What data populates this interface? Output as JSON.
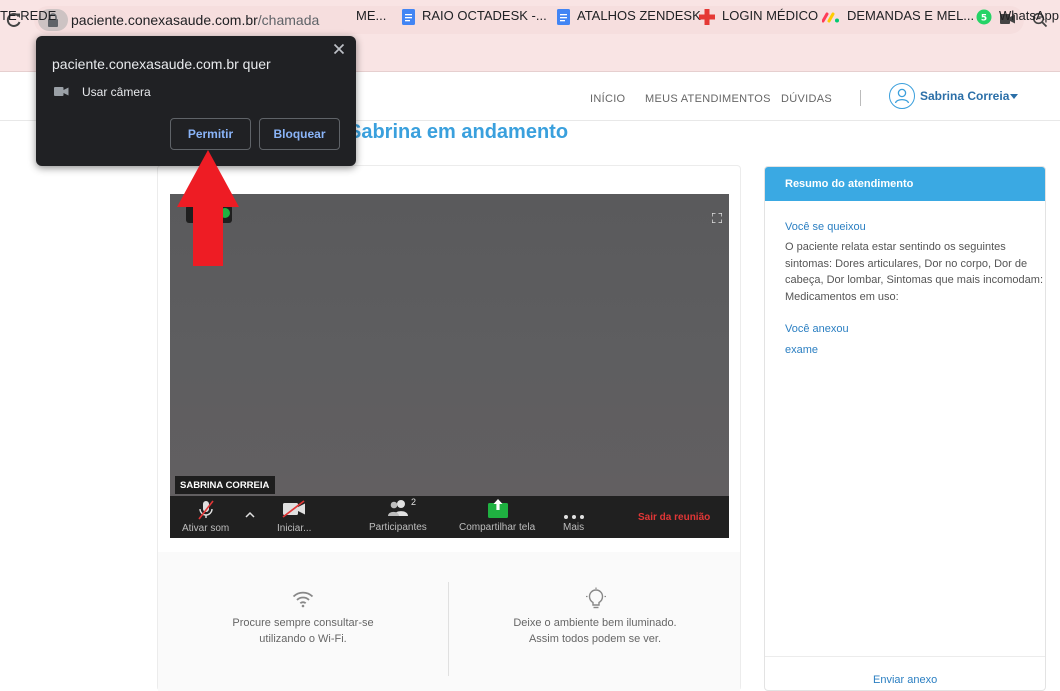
{
  "browser": {
    "url_domain": "paciente.conexasaude.com.br",
    "url_path": "/chamada"
  },
  "bookmarks": [
    {
      "label": "TE REDE"
    },
    {
      "label": "ME..."
    },
    {
      "label": "RAIO OCTADESK -..."
    },
    {
      "label": "ATALHOS ZENDESK"
    },
    {
      "label": "LOGIN MÉDICO"
    },
    {
      "label": "DEMANDAS E MEL..."
    },
    {
      "label": "WhatsApp"
    }
  ],
  "nav": {
    "inicio": "INÍCIO",
    "meus_atendimentos": "MEUS ATENDIMENTOS",
    "duvidas": "DÚVIDAS",
    "user_name": "Sabrina Correia"
  },
  "page": {
    "title": "Sabrina em andamento"
  },
  "video": {
    "participant_name": "SABRINA CORREIA",
    "participant_count": "2",
    "controls": {
      "mute": "Ativar som",
      "video": "Iniciar...",
      "participants": "Participantes",
      "share": "Compartilhar tela",
      "more": "Mais",
      "leave": "Sair da reunião"
    }
  },
  "tips": {
    "wifi_line1": "Procure sempre consultar-se",
    "wifi_line2": "utilizando o Wi-Fi.",
    "light_line1": "Deixe o ambiente bem iluminado.",
    "light_line2": "Assim todos podem se ver."
  },
  "summary": {
    "header": "Resumo do atendimento",
    "complaint_label": "Você se queixou",
    "complaint_text": "O paciente relata estar sentindo os seguintes sintomas: Dores articulares, Dor no corpo, Dor de cabeça, Dor lombar, Sintomas que mais incomodam: Medicamentos em uso:",
    "attached_label": "Você anexou",
    "attachment": "exame",
    "send_attachment": "Enviar anexo"
  },
  "permission": {
    "site": "paciente.conexasaude.com.br quer",
    "request": "Usar câmera",
    "allow": "Permitir",
    "block": "Bloquear"
  },
  "colors": {
    "accent": "#3aa0dd",
    "leave_red": "#e23636",
    "popup_bg": "#202124",
    "arrow_red": "#ee1c24",
    "share_green": "#1fb141"
  }
}
